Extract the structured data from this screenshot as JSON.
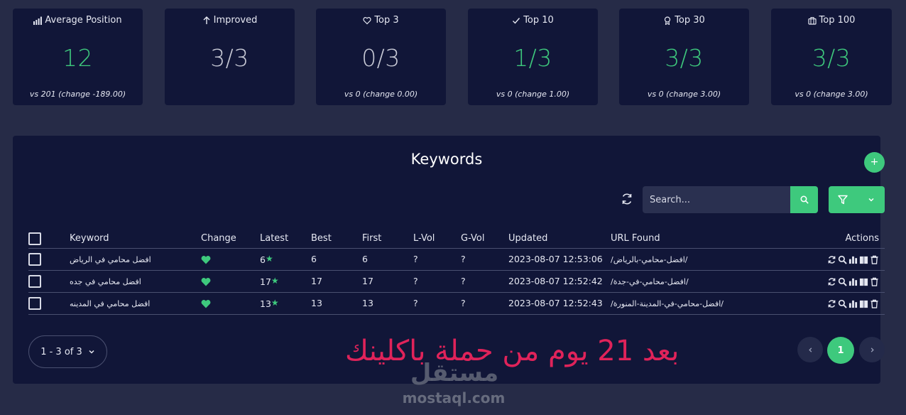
{
  "stats": [
    {
      "title": "Average Position",
      "icon": "bar-chart-icon",
      "value": "12",
      "sub": "vs 201 (change -189.00)"
    },
    {
      "title": "Improved",
      "icon": "arrow-up-icon",
      "value": "3/3",
      "sub": ""
    },
    {
      "title": "Top 3",
      "icon": "heart-icon",
      "value": "0/3",
      "sub": "vs 0 (change 0.00)"
    },
    {
      "title": "Top 10",
      "icon": "check-icon",
      "value": "1/3",
      "sub": "vs 0 (change 1.00)"
    },
    {
      "title": "Top 30",
      "icon": "award-icon",
      "value": "3/3",
      "sub": "vs 0 (change 3.00)"
    },
    {
      "title": "Top 100",
      "icon": "briefcase-icon",
      "value": "3/3",
      "sub": "vs 0 (change 3.00)"
    }
  ],
  "colors": {
    "accent": "#3ec97d",
    "background": "#262b47",
    "panel": "#111638",
    "overlay": "#e0235a"
  },
  "keywords": {
    "title": "Keywords",
    "add_label": "+",
    "search_placeholder": "Search...",
    "columns": [
      "Keyword",
      "Change",
      "Latest",
      "Best",
      "First",
      "L-Vol",
      "G-Vol",
      "Updated",
      "URL Found",
      "Actions"
    ],
    "rows": [
      {
        "keyword": "افضل محامي في الرياض",
        "latest": "6",
        "best": "6",
        "first": "6",
        "lvol": "?",
        "gvol": "?",
        "updated": "2023-08-07 12:53:06",
        "url": "/افضل-محامي-بالرياض/"
      },
      {
        "keyword": "افضل محامي في جده",
        "latest": "17",
        "best": "17",
        "first": "17",
        "lvol": "?",
        "gvol": "?",
        "updated": "2023-08-07 12:52:42",
        "url": "/افضل-محامي-في-جدة/"
      },
      {
        "keyword": "افضل محامي في المدينه",
        "latest": "13",
        "best": "13",
        "first": "13",
        "lvol": "?",
        "gvol": "?",
        "updated": "2023-08-07 12:52:43",
        "url": "/افضل-محامي-في-المدينة-المنورة/"
      }
    ],
    "page_size_label": "1 - 3 of 3",
    "current_page": "1"
  },
  "overlay_text": "بعد 21 يوم من حملة باكلينك",
  "watermark": {
    "arabic": "مستقل",
    "latin": "mostaql.com"
  }
}
